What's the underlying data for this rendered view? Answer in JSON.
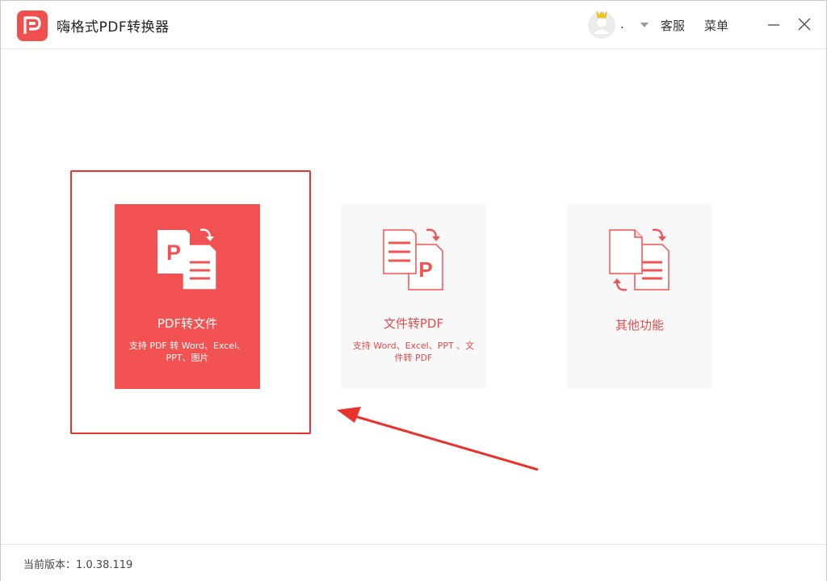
{
  "app": {
    "title": "嗨格式PDF转换器",
    "logo_icon": "pdf-app-logo",
    "accent_color": "#f25252"
  },
  "titlebar": {
    "user_name": ".",
    "customer_service_label": "客服",
    "menu_label": "菜单",
    "minimize_icon": "minimize-icon",
    "close_icon": "close-icon",
    "vip_crown_color": "#f5c518"
  },
  "features": [
    {
      "title": "PDF转文件",
      "description": "支持 PDF 转 Word、Excel、PPT、图片",
      "icon": "pdf-to-file-icon",
      "selected": true
    },
    {
      "title": "文件转PDF",
      "description": "支持 Word、Excel、PPT 、文件转 PDF",
      "icon": "file-to-pdf-icon",
      "selected": false
    },
    {
      "title": "其他功能",
      "description": "",
      "icon": "other-functions-icon",
      "selected": false
    }
  ],
  "footer": {
    "version_label": "当前版本：1.0.38.119"
  }
}
